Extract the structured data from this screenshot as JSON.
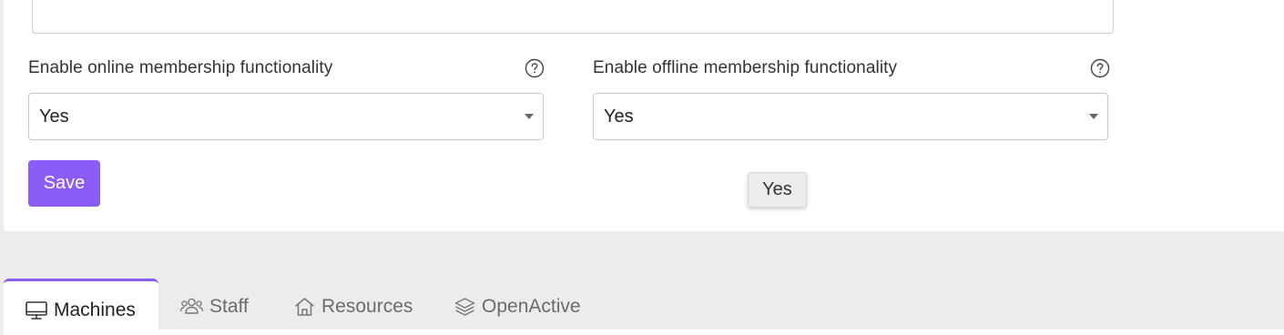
{
  "form": {
    "online_label": "Enable online membership functionality",
    "online_value": "Yes",
    "offline_label": "Enable offline membership functionality",
    "offline_value": "Yes",
    "save_label": "Save",
    "tooltip_text": "Yes"
  },
  "tabs": [
    {
      "label": "Machines",
      "icon": "monitor-icon",
      "active": true
    },
    {
      "label": "Staff",
      "icon": "users-icon",
      "active": false
    },
    {
      "label": "Resources",
      "icon": "home-icon",
      "active": false
    },
    {
      "label": "OpenActive",
      "icon": "layers-icon",
      "active": false
    }
  ],
  "colors": {
    "accent": "#8b5cf6",
    "background": "#ececec",
    "card": "#ffffff"
  }
}
